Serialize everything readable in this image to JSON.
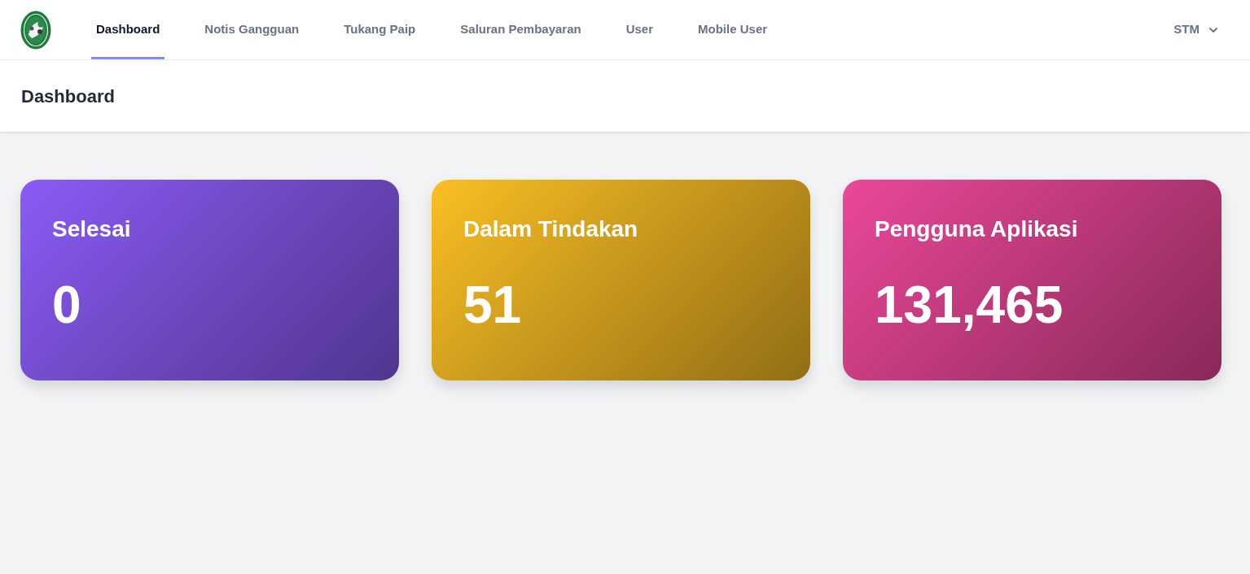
{
  "nav": {
    "items": [
      {
        "label": "Dashboard",
        "selected": true
      },
      {
        "label": "Notis Gangguan",
        "selected": false
      },
      {
        "label": "Tukang Paip",
        "selected": false
      },
      {
        "label": "Saluran Pembayaran",
        "selected": false
      },
      {
        "label": "User",
        "selected": false
      },
      {
        "label": "Mobile User",
        "selected": false
      }
    ],
    "user_menu": {
      "label": "STM"
    }
  },
  "header": {
    "title": "Dashboard"
  },
  "cards": [
    {
      "title": "Selesai",
      "value": "0",
      "color": "#8b5cf6"
    },
    {
      "title": "Dalam Tindakan",
      "value": "51",
      "color": "#fbbf24"
    },
    {
      "title": "Pengguna Aplikasi",
      "value": "131,465",
      "color": "#ec4899"
    }
  ]
}
